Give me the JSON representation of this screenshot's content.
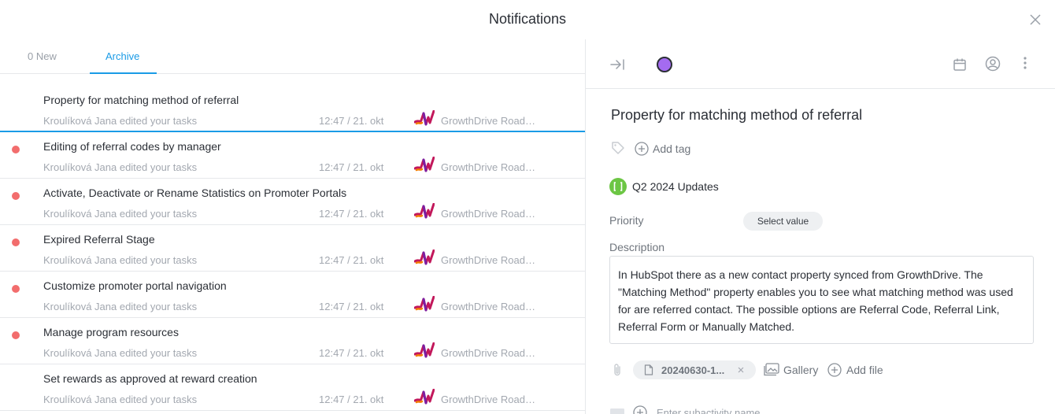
{
  "header": {
    "title": "Notifications"
  },
  "tabs": [
    {
      "label": "0 New"
    },
    {
      "label": "Archive"
    }
  ],
  "notifications": [
    {
      "title": "Property for matching method of referral",
      "subtitle": "Kroulíková Jana edited your tasks",
      "time": "12:47 / 21. okt",
      "project": "GrowthDrive Roadmap",
      "unread": false,
      "selected": true
    },
    {
      "title": "Editing of referral codes by manager",
      "subtitle": "Kroulíková Jana edited your tasks",
      "time": "12:47 / 21. okt",
      "project": "GrowthDrive Roadmap",
      "unread": true
    },
    {
      "title": "Activate, Deactivate or Rename Statistics on Promoter Portals",
      "subtitle": "Kroulíková Jana edited your tasks",
      "time": "12:47 / 21. okt",
      "project": "GrowthDrive Roadmap",
      "unread": true
    },
    {
      "title": "Expired Referral Stage",
      "subtitle": "Kroulíková Jana edited your tasks",
      "time": "12:47 / 21. okt",
      "project": "GrowthDrive Roadmap",
      "unread": true
    },
    {
      "title": "Customize promoter portal navigation",
      "subtitle": "Kroulíková Jana edited your tasks",
      "time": "12:47 / 21. okt",
      "project": "GrowthDrive Roadmap",
      "unread": true
    },
    {
      "title": "Manage program resources",
      "subtitle": "Kroulíková Jana edited your tasks",
      "time": "12:47 / 21. okt",
      "project": "GrowthDrive Roadmap",
      "unread": true
    },
    {
      "title": "Set rewards as approved at reward creation",
      "subtitle": "Kroulíková Jana edited your tasks",
      "time": "12:47 / 21. okt",
      "project": "GrowthDrive Roadmap",
      "unread": false
    }
  ],
  "detail": {
    "title": "Property for matching method of referral",
    "add_tag": "Add tag",
    "project": "Q2 2024 Updates",
    "priority_label": "Priority",
    "priority_value": "Select value",
    "description_label": "Description",
    "description": "In HubSpot there as a new contact property synced from GrowthDrive. The \"Matching Method\" property enables you to see what matching method was used for are referred contact. The possible options are Referral Code, Referral Link, Referral Form or Manually Matched.",
    "file_name": "20240630-1...",
    "gallery_label": "Gallery",
    "add_file_label": "Add file",
    "subactivity_placeholder": "Enter subactivity name"
  },
  "colors": {
    "accent": "#1a9be6",
    "unread_dot": "#f26d6d",
    "status_circle": "#a46bf0",
    "project_icon": "#6cc644"
  }
}
